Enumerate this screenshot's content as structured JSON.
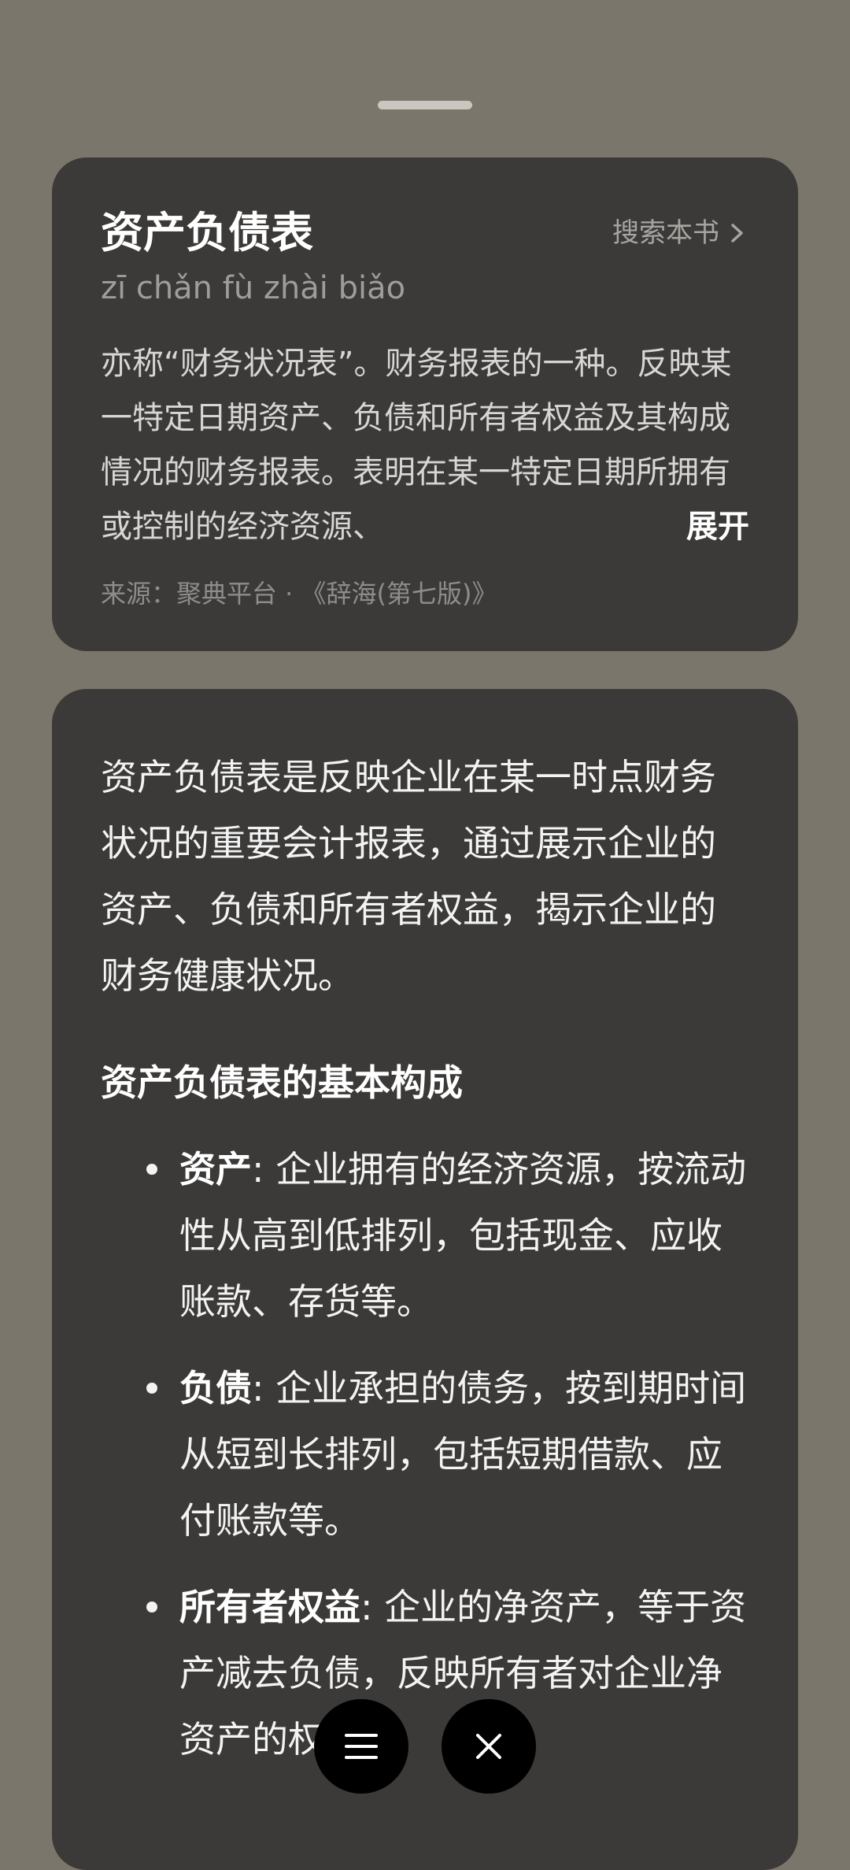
{
  "dictionary": {
    "term": "资产负债表",
    "search_link": "搜索本书",
    "pinyin": "zī chǎn fù zhài biǎo",
    "definition": "亦称“财务状况表”。财务报表的一种。反映某一特定日期资产、负债和所有者权益及其构成情况的财务报表。表明在某一特定日期所拥有或控制的经济资源、",
    "expand_label": "展开",
    "source": "来源：聚典平台 · 《辞海(第七版)》"
  },
  "answer": {
    "intro": "资产负债表是反映企业在某一时点财务状况的重要会计报表，通过展示企业的资产、负债和所有者权益，揭示企业的财务健康状况。",
    "section_title": "资产负债表的基本构成",
    "items": [
      {
        "term": "资产",
        "text": ": 企业拥有的经济资源，按流动性从高到低排列，包括现金、应收账款、存货等。"
      },
      {
        "term": "负债",
        "text": ": 企业承担的债务，按到期时间从短到长排列，包括短期借款、应付账款等。"
      },
      {
        "term": "所有者权益",
        "text": ": 企业的净资产，等于资产减去负债，反映所有者对企业净资产的权"
      }
    ]
  },
  "controls": {
    "menu_icon": "menu-icon",
    "close_icon": "close-icon"
  },
  "colors": {
    "background": "#7b766b",
    "card": "#3b3a38",
    "fab": "#000000"
  }
}
